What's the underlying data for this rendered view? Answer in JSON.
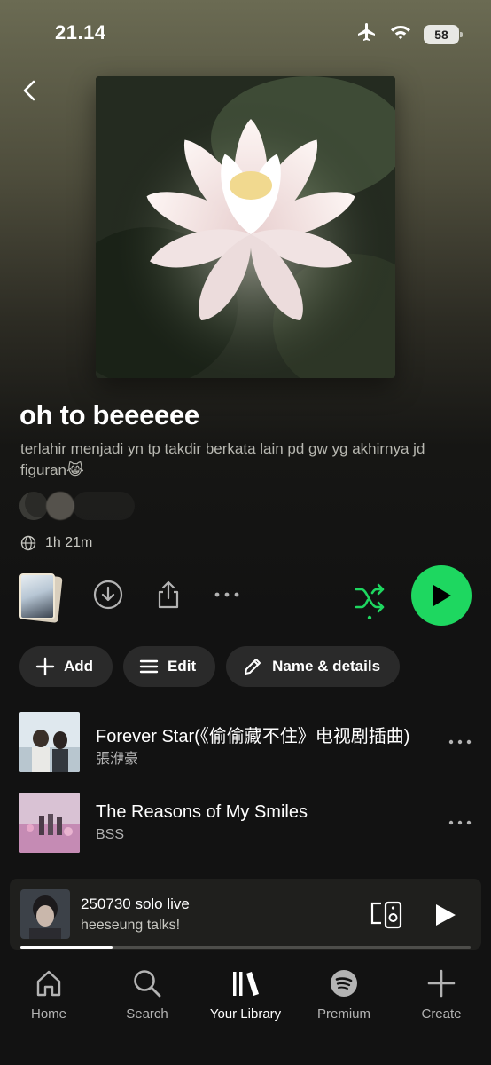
{
  "status_bar": {
    "time": "21.14",
    "battery": "58"
  },
  "playlist": {
    "title": "oh to beeeeee",
    "description": "terlahir menjadi yn tp takdir berkata lain pd gw yg akhirnya jd figuran😹",
    "duration": "1h 21m"
  },
  "chips": {
    "add": "Add",
    "edit": "Edit",
    "name_details": "Name & details"
  },
  "tracks": [
    {
      "title": "Forever Star(《偷偷藏不住》电视剧插曲)",
      "artist": "張洢豪"
    },
    {
      "title": "The Reasons of My Smiles",
      "artist": "BSS"
    }
  ],
  "mini_player": {
    "title": "250730 solo live",
    "subtitle": "heeseung talks!",
    "progress": 0.205
  },
  "nav": {
    "home": "Home",
    "search": "Search",
    "library": "Your Library",
    "premium": "Premium",
    "create": "Create"
  },
  "colors": {
    "accent": "#1ed760",
    "background": "#121212",
    "chip": "#2a2a2a"
  },
  "icons": [
    "back-icon",
    "airplane-icon",
    "wifi-icon",
    "globe-icon",
    "download-icon",
    "share-icon",
    "more-icon",
    "shuffle-icon",
    "play-icon",
    "plus-icon",
    "menu-icon",
    "pencil-icon",
    "devices-icon",
    "home-icon",
    "search-icon",
    "library-icon",
    "premium-icon",
    "create-icon"
  ]
}
